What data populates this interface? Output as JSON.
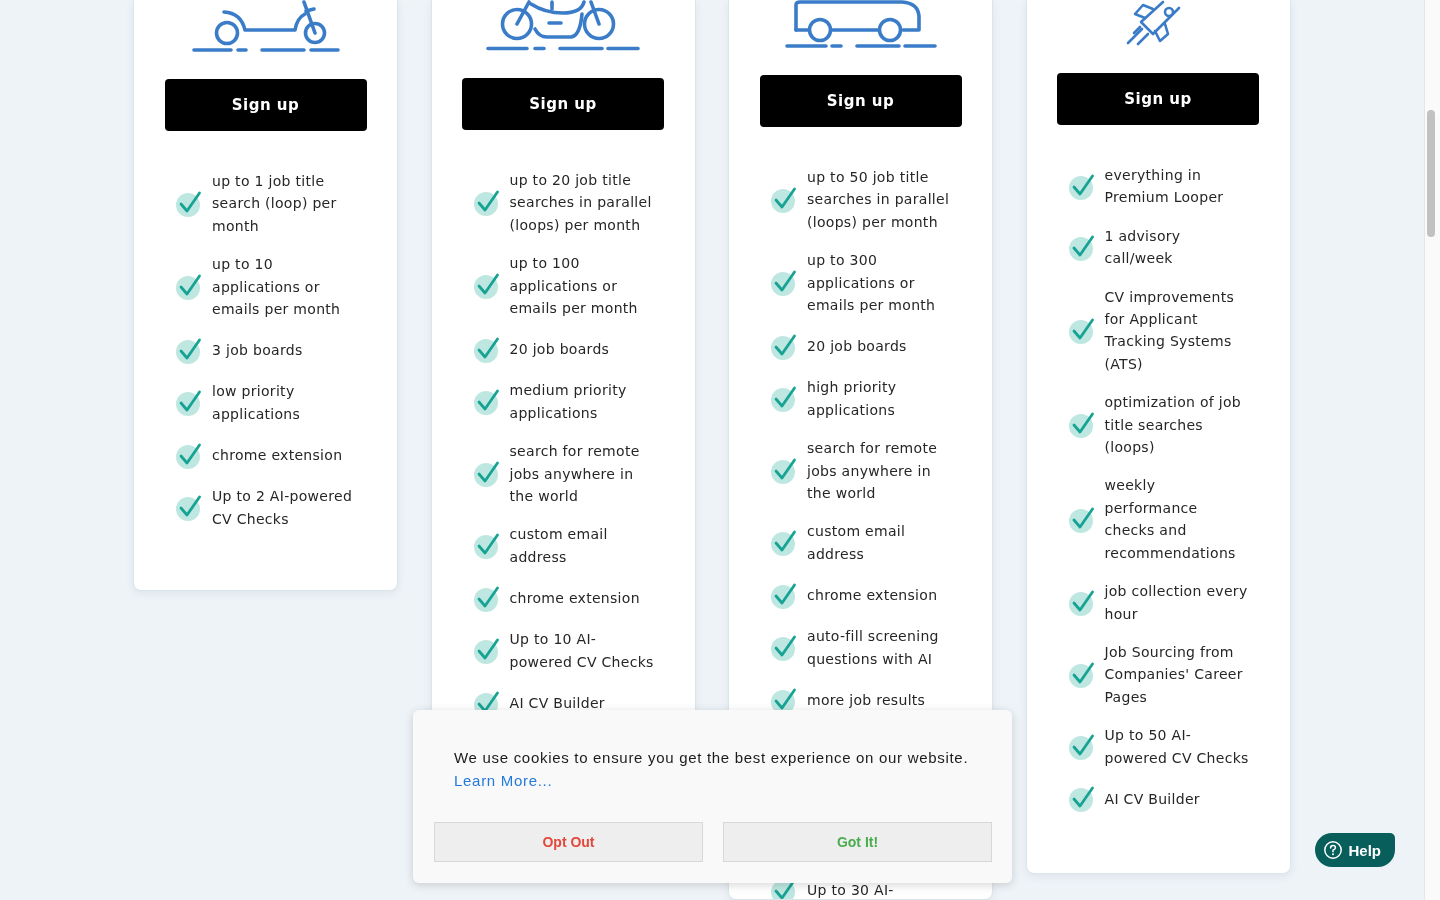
{
  "plans": [
    {
      "button": "Sign up",
      "features": [
        "up to 1 job title search (loop) per month",
        "up to 10 applications or emails per month",
        "3 job boards",
        "low priority applications",
        "chrome extension",
        "Up to 2 AI-powered CV Checks"
      ]
    },
    {
      "button": "Sign up",
      "features": [
        "up to 20 job title searches in parallel (loops) per month",
        "up to 100 applications or emails per month",
        "20 job boards",
        "medium priority applications",
        "search for remote jobs anywhere in the world",
        "custom email address",
        "chrome extension",
        "Up to 10 AI-powered CV Checks",
        "AI CV Builder"
      ]
    },
    {
      "button": "Sign up",
      "features": [
        "up to 50 job title searches in parallel (loops) per month",
        "up to 300 applications or emails per month",
        "20 job boards",
        "high priority applications",
        "search for remote jobs anywhere in the world",
        "custom email address",
        "chrome extension",
        "auto-fill screening questions with AI",
        "more job results"
      ],
      "features_below_banner": [
        "Up to 30 AI-"
      ]
    },
    {
      "button": "Sign up",
      "features": [
        "everything in Premium Looper",
        "1 advisory call/week",
        "CV improvements for Applicant Tracking Systems (ATS)",
        "optimization of job title searches (loops)",
        "weekly performance checks and recommendations",
        "job collection every hour",
        "Job Sourcing from Companies' Career Pages",
        "Up to 50 AI-powered CV Checks",
        "AI CV Builder"
      ]
    }
  ],
  "cookie_banner": {
    "message": "We use cookies to ensure you get the best experience on our website.",
    "link": "Learn More...",
    "buttons": [
      {
        "label": "Opt Out",
        "kind": "decline"
      },
      {
        "label": "Got It!",
        "kind": "accept"
      }
    ]
  },
  "help_button": {
    "label": "Help"
  }
}
